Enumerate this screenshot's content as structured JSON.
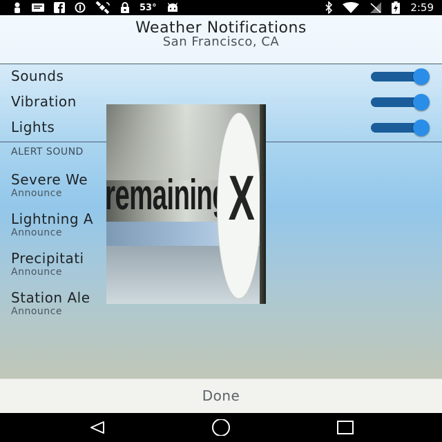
{
  "status_bar": {
    "temperature": "53°",
    "time": "2:59",
    "icons_left": [
      "person-icon",
      "message-icon",
      "facebook-icon",
      "data-saver-icon",
      "satellite-icon",
      "lock-icon",
      "android-icon"
    ],
    "icons_right": [
      "bluetooth-icon",
      "wifi-icon",
      "no-sim-icon",
      "battery-charging-icon"
    ]
  },
  "header": {
    "title": "Weather Notifications",
    "subtitle": "San Francisco, CA"
  },
  "toggles": [
    {
      "label": "Sounds",
      "on": true
    },
    {
      "label": "Vibration",
      "on": true
    },
    {
      "label": "Lights",
      "on": true
    }
  ],
  "section_header": "ALERT SOUND",
  "alerts": [
    {
      "title": "Severe We",
      "subtitle": "Announce"
    },
    {
      "title": "Lightning A",
      "subtitle": "Announce"
    },
    {
      "title": "Precipitati",
      "subtitle": "Announce"
    },
    {
      "title": "Station Ale",
      "subtitle": "Announce"
    }
  ],
  "overlay": {
    "text": "remaining",
    "close_glyph": "X"
  },
  "done_label": "Done",
  "nav": [
    "back-icon",
    "home-icon",
    "recents-icon"
  ],
  "colors": {
    "switch_track": "#1a5d9a",
    "switch_knob": "#2a8ee8",
    "status_bar": "#000000",
    "done_bar": "#f2f2ef"
  }
}
